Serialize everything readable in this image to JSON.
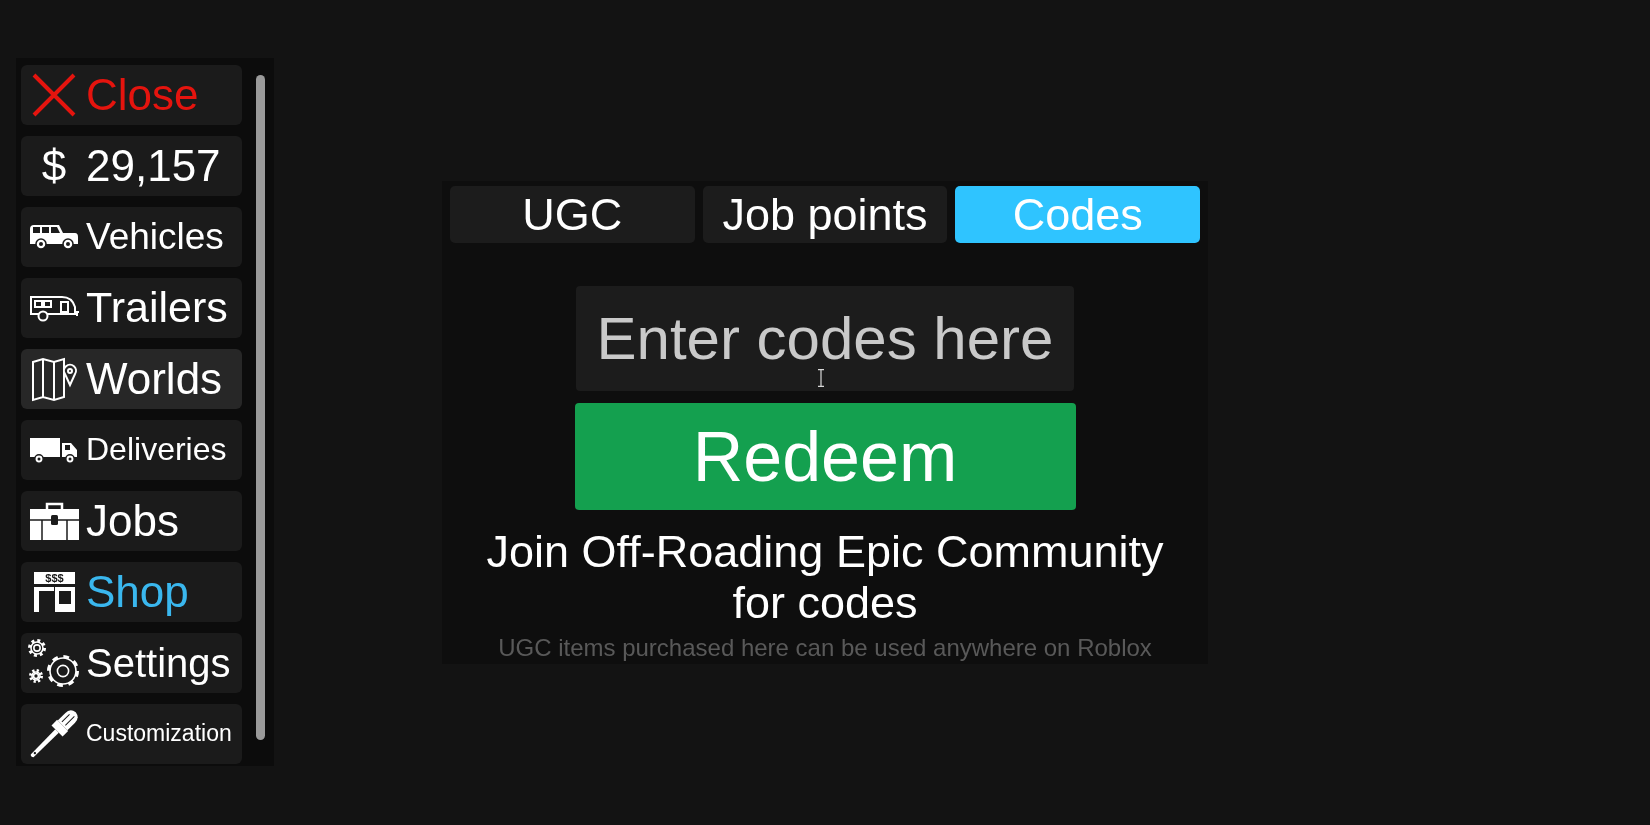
{
  "sidebar": {
    "items": [
      {
        "kind": "close",
        "label": "Close",
        "selected": false,
        "hovered": false
      },
      {
        "kind": "balance",
        "symbol": "$",
        "label": "29,157",
        "selected": false,
        "hovered": false
      },
      {
        "kind": "vehicles",
        "label": "Vehicles",
        "selected": false,
        "hovered": false
      },
      {
        "kind": "trailers",
        "label": "Trailers",
        "selected": false,
        "hovered": false
      },
      {
        "kind": "worlds",
        "label": "Worlds",
        "selected": false,
        "hovered": true
      },
      {
        "kind": "deliveries",
        "label": "Deliveries",
        "selected": false,
        "hovered": false
      },
      {
        "kind": "jobs",
        "label": "Jobs",
        "selected": false,
        "hovered": false
      },
      {
        "kind": "shop",
        "label": "Shop",
        "sign_text": "$$$",
        "selected": true,
        "hovered": false
      },
      {
        "kind": "settings",
        "label": "Settings",
        "selected": false,
        "hovered": false
      },
      {
        "kind": "customization",
        "label": "Customization",
        "selected": false,
        "hovered": false
      }
    ]
  },
  "tabs": [
    {
      "label": "UGC",
      "selected": false
    },
    {
      "label": "Job points",
      "selected": false
    },
    {
      "label": "Codes",
      "selected": true
    }
  ],
  "codes": {
    "input": {
      "placeholder": "Enter codes here"
    },
    "redeem_button": {
      "label": "Redeem"
    },
    "hint": "Join Off-Roading Epic Community for codes",
    "footnote": "UGC items purchased here can be used anywhere on Roblox"
  }
}
